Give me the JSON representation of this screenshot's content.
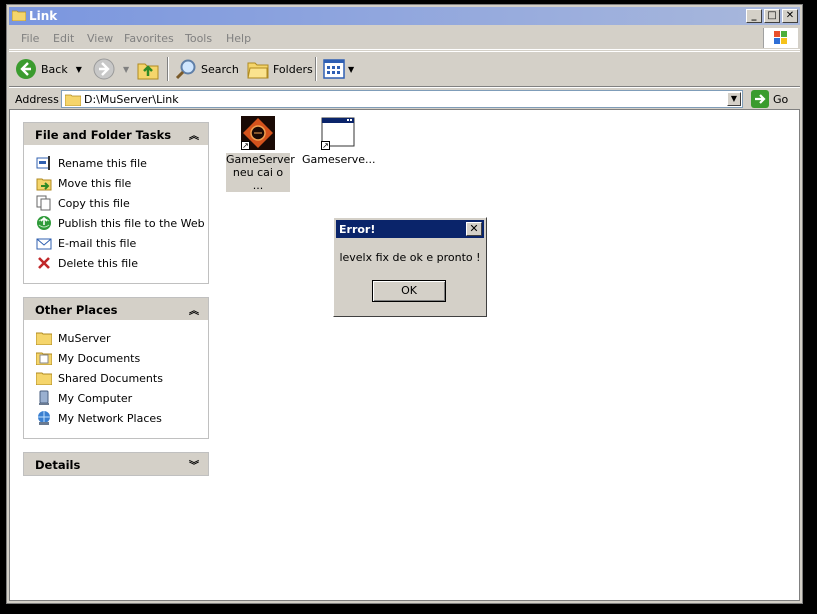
{
  "window": {
    "title": "Link"
  },
  "menu": [
    "File",
    "Edit",
    "View",
    "Favorites",
    "Tools",
    "Help"
  ],
  "toolbar": {
    "back": "Back",
    "search": "Search",
    "folders": "Folders"
  },
  "address": {
    "label": "Address",
    "path": "D:\\MuServer\\Link",
    "go": "Go"
  },
  "panels": {
    "tasks": {
      "title": "File and Folder Tasks",
      "items": [
        "Rename this file",
        "Move this file",
        "Copy this file",
        "Publish this file to the Web",
        "E-mail this file",
        "Delete this file"
      ]
    },
    "places": {
      "title": "Other Places",
      "items": [
        "MuServer",
        "My Documents",
        "Shared Documents",
        "My Computer",
        "My Network Places"
      ]
    },
    "details": {
      "title": "Details"
    }
  },
  "files": [
    {
      "line1": "GameServer",
      "line2": "neu cai o ..."
    },
    {
      "line1": "Gameserve..."
    }
  ],
  "dialog": {
    "title": "Error!",
    "message": "levelx fix de ok e pronto !",
    "ok": "OK"
  }
}
